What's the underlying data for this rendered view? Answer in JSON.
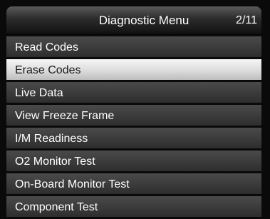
{
  "header": {
    "title": "Diagnostic Menu",
    "page_indicator": "2/11"
  },
  "menu": {
    "selected_index": 1,
    "items": [
      {
        "label": "Read Codes"
      },
      {
        "label": "Erase Codes"
      },
      {
        "label": "Live Data"
      },
      {
        "label": "View Freeze Frame"
      },
      {
        "label": "I/M Readiness"
      },
      {
        "label": "O2 Monitor Test"
      },
      {
        "label": "On-Board Monitor Test"
      },
      {
        "label": "Component Test"
      }
    ]
  },
  "colors": {
    "background": "#0a0a0a",
    "item": "#3a3a3a",
    "selected_item": "#e0e0e0",
    "text": "#ffffff",
    "selected_text": "#1a1a1a"
  }
}
